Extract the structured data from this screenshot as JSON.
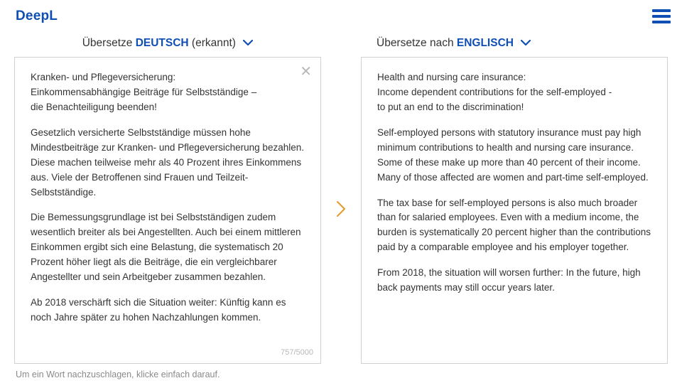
{
  "header": {
    "brand": "DeepL"
  },
  "source": {
    "label_prefix": "Übersetze ",
    "language": "DEUTSCH",
    "detected_suffix": " (erkannt)",
    "text": {
      "p1": "Kranken- und Pflegeversicherung:\nEinkommensabhängige Beiträge für Selbstständige –\ndie Benachteiligung beenden!",
      "p2": "Gesetzlich versicherte Selbstständige müssen hohe Mindestbeiträge zur Kranken- und Pflegeversicherung bezahlen. Diese machen teilweise mehr als 40 Prozent ihres Einkommens aus. Viele der Betroffenen sind Frauen und Teilzeit-Selbstständige.",
      "p3": "Die Bemessungsgrundlage ist bei Selbstständigen zudem wesentlich breiter als bei Angestellten. Auch bei einem mittleren Einkommen ergibt sich eine Belastung, die systematisch 20 Prozent höher liegt als die Beiträge, die ein vergleichbarer Angestellter und sein Arbeitgeber zusammen bezahlen.",
      "p4": "Ab 2018 verschärft sich die Situation weiter: Künftig kann es noch Jahre später zu hohen Nachzahlungen kommen."
    },
    "char_count": "757/5000"
  },
  "target": {
    "label_prefix": "Übersetze nach ",
    "language": "ENGLISCH",
    "text": {
      "p1": "Health and nursing care insurance:\nIncome dependent contributions for the self-employed -\nto put an end to the discrimination!",
      "p2": "Self-employed persons with statutory insurance must pay high minimum contributions to health and nursing care insurance. Some of these make up more than 40 percent of their income. Many of those affected are women and part-time self-employed.",
      "p3": "The tax base for self-employed persons is also much broader than for salaried employees. Even with a medium income, the burden is systematically 20 percent higher than the contributions paid by a comparable employee and his employer together.",
      "p4": "From 2018, the situation will worsen further: In the future, high back payments may still occur years later."
    }
  },
  "hint": "Um ein Wort nachzuschlagen, klicke einfach darauf."
}
